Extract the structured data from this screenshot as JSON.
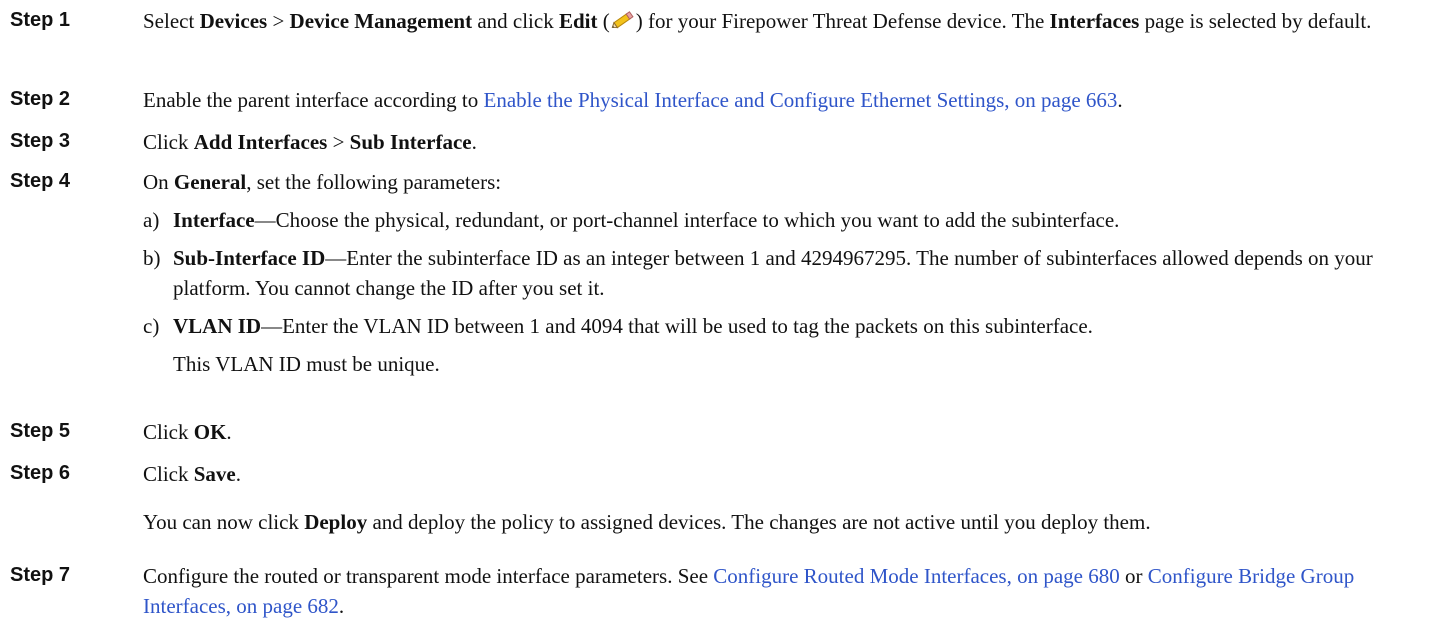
{
  "steps": [
    {
      "label": "Step 1",
      "t1": "Select ",
      "b1": "Devices",
      "t2": " > ",
      "b2": "Device Management",
      "t3": " and click ",
      "b3": "Edit",
      "t4": " (",
      "icon": "pencil-edit-icon",
      "t5": ") for your Firepower Threat Defense device. The ",
      "b4": "Interfaces",
      "t6": " page is selected by default."
    },
    {
      "label": "Step 2",
      "t1": "Enable the parent interface according to ",
      "link": "Enable the Physical Interface and Configure Ethernet Settings, on page 663",
      "t2": "."
    },
    {
      "label": "Step 3",
      "t1": "Click ",
      "b1": "Add Interfaces",
      "t2": " > ",
      "b2": "Sub Interface",
      "t3": "."
    },
    {
      "label": "Step 4",
      "t1": "On ",
      "b1": "General",
      "t2": ", set the following parameters:",
      "items": [
        {
          "marker": "a)",
          "term": "Interface",
          "text": "—Choose the physical, redundant, or port-channel interface to which you want to add the subinterface."
        },
        {
          "marker": "b)",
          "term": "Sub-Interface ID",
          "text": "—Enter the subinterface ID as an integer between 1 and 4294967295. The number of subinterfaces allowed depends on your platform. You cannot change the ID after you set it."
        },
        {
          "marker": "c)",
          "term": "VLAN ID",
          "text": "—Enter the VLAN ID between 1 and 4094 that will be used to tag the packets on this subinterface."
        }
      ],
      "note": "This VLAN ID must be unique."
    },
    {
      "label": "Step 5",
      "t1": "Click ",
      "b1": "OK",
      "t2": "."
    },
    {
      "label": "Step 6",
      "t1": "Click ",
      "b1": "Save",
      "t2": ".",
      "p2_t1": "You can now click ",
      "p2_b1": "Deploy",
      "p2_t2": " and deploy the policy to assigned devices. The changes are not active until you deploy them."
    },
    {
      "label": "Step 7",
      "t1": "Configure the routed or transparent mode interface parameters. See ",
      "link1": "Configure Routed Mode Interfaces, on page 680",
      "t2": " or ",
      "link2": "Configure Bridge Group Interfaces, on page 682",
      "t3": "."
    }
  ],
  "colors": {
    "link": "#2f55c9",
    "text": "#111111"
  }
}
